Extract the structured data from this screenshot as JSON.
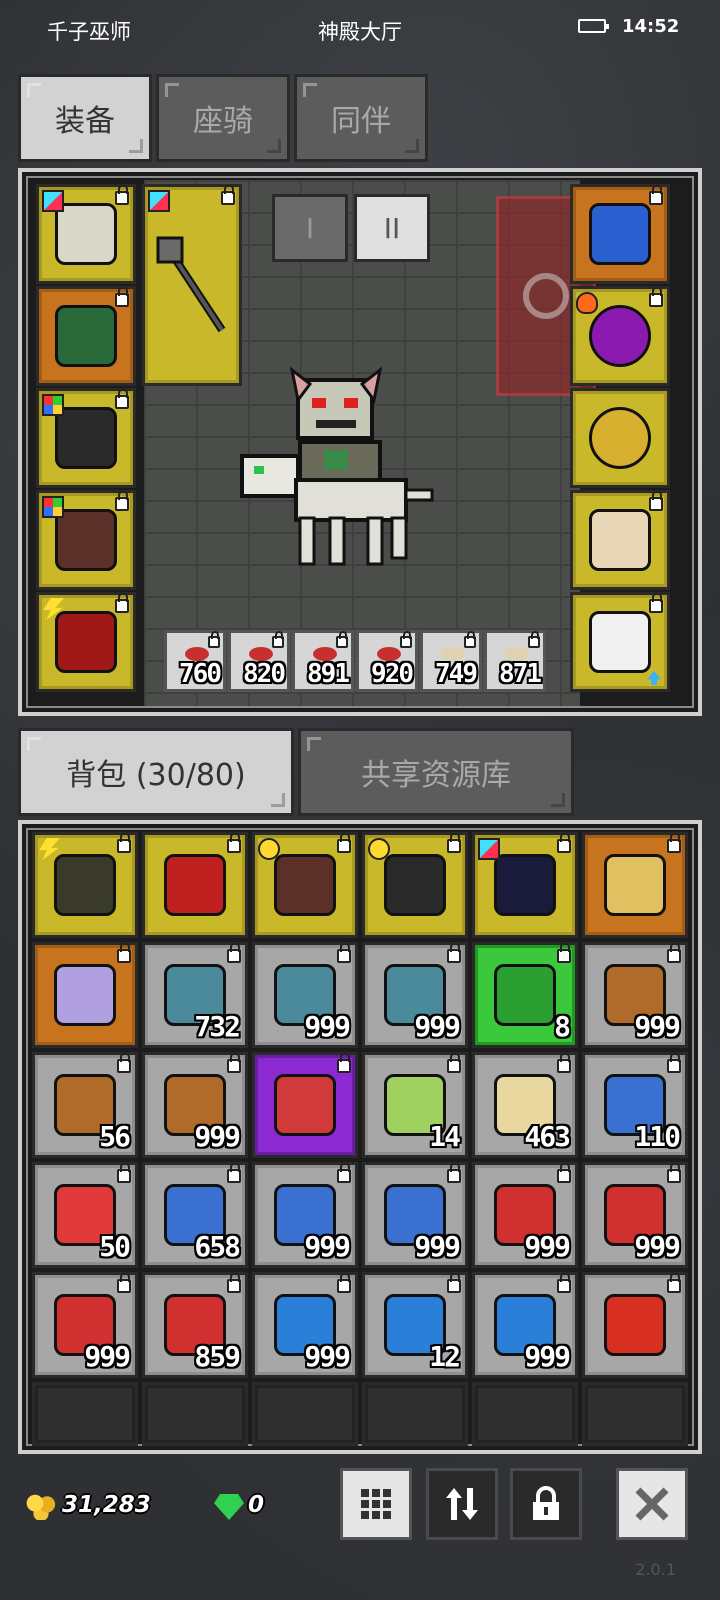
{
  "status": {
    "left": "千子巫师",
    "center": "神殿大厅",
    "time": "14:52"
  },
  "tabs": [
    {
      "label": "装备",
      "active": true
    },
    {
      "label": "座骑",
      "active": false
    },
    {
      "label": "同伴",
      "active": false
    }
  ],
  "equipment": {
    "page_buttons": [
      "I",
      "II"
    ],
    "active_page": "II",
    "left_slots": [
      {
        "name": "skull-helmet-icon",
        "color": "yellow",
        "badge": "cyan"
      },
      {
        "name": "green-armor-icon",
        "color": "orange",
        "badge": ""
      },
      {
        "name": "black-gauntlet-icon",
        "color": "yellow",
        "badge": "multi"
      },
      {
        "name": "leather-boots-icon",
        "color": "yellow",
        "badge": "multi"
      },
      {
        "name": "red-bag-icon",
        "color": "yellow",
        "badge": "bolt"
      }
    ],
    "weapon_slot": {
      "name": "mace-weapon-icon",
      "color": "yellow",
      "badge": "cyan"
    },
    "right_slots": [
      {
        "name": "blue-amulet-icon",
        "color": "orange",
        "badge": ""
      },
      {
        "name": "purple-gem-ring-icon",
        "color": "yellow",
        "badge": "fire"
      },
      {
        "name": "gold-ring-icon",
        "color": "yellow",
        "badge": ""
      },
      {
        "name": "skeleton-horse-card-icon",
        "color": "yellow",
        "badge": ""
      },
      {
        "name": "white-pet-icon",
        "color": "yellow",
        "badge": ""
      }
    ],
    "consumables": [
      {
        "qty": "760",
        "kind": "red"
      },
      {
        "qty": "820",
        "kind": "red"
      },
      {
        "qty": "891",
        "kind": "red"
      },
      {
        "qty": "920",
        "kind": "red"
      },
      {
        "qty": "749",
        "kind": "beige"
      },
      {
        "qty": "871",
        "kind": "beige"
      }
    ]
  },
  "bag_tabs": [
    {
      "label": "背包 (30/80)",
      "active": true
    },
    {
      "label": "共享资源库",
      "active": false
    }
  ],
  "bag": [
    {
      "name": "black-belt-icon",
      "color": "yellow",
      "qty": "",
      "badge": "bolt",
      "fill": "#3a3a2a"
    },
    {
      "name": "ruby-ring-icon",
      "color": "yellow",
      "qty": "",
      "badge": "",
      "fill": "#c02020"
    },
    {
      "name": "boots-icon",
      "color": "yellow",
      "qty": "",
      "badge": "sun",
      "fill": "#5a3028"
    },
    {
      "name": "gauntlet-icon",
      "color": "yellow",
      "qty": "",
      "badge": "sun",
      "fill": "#2a2a2a"
    },
    {
      "name": "flail-icon",
      "color": "yellow",
      "qty": "",
      "badge": "cyan",
      "fill": "#1a1a3a"
    },
    {
      "name": "moon-shield-icon",
      "color": "orange",
      "qty": "",
      "badge": "",
      "fill": "#e0c060"
    },
    {
      "name": "wizard-card-icon",
      "color": "orange",
      "qty": "",
      "badge": "",
      "fill": "#b0a0e0"
    },
    {
      "name": "fish-icon",
      "color": "gray",
      "qty": "732",
      "badge": "",
      "fill": "#4a8a9a"
    },
    {
      "name": "fish-icon",
      "color": "gray",
      "qty": "999",
      "badge": "",
      "fill": "#4a8a9a"
    },
    {
      "name": "fish-icon",
      "color": "gray",
      "qty": "999",
      "badge": "",
      "fill": "#4a8a9a"
    },
    {
      "name": "green-feather-icon",
      "color": "green",
      "qty": "8",
      "badge": "",
      "fill": "#2aa030"
    },
    {
      "name": "bread-icon",
      "color": "gray",
      "qty": "999",
      "badge": "",
      "fill": "#b06a2a"
    },
    {
      "name": "bread-icon",
      "color": "gray",
      "qty": "56",
      "badge": "",
      "fill": "#b06a2a"
    },
    {
      "name": "bread-icon",
      "color": "gray",
      "qty": "999",
      "badge": "",
      "fill": "#b06a2a"
    },
    {
      "name": "gem-chest-icon",
      "color": "purple",
      "qty": "",
      "badge": "",
      "fill": "#d03a3a"
    },
    {
      "name": "green-bag-icon",
      "color": "gray",
      "qty": "14",
      "badge": "",
      "fill": "#a0d060"
    },
    {
      "name": "scroll-icon",
      "color": "gray",
      "qty": "463",
      "badge": "",
      "fill": "#e8d8a0"
    },
    {
      "name": "blue-potion-icon",
      "color": "gray",
      "qty": "110",
      "badge": "",
      "fill": "#3a70d0"
    },
    {
      "name": "red-potion-icon",
      "color": "gray",
      "qty": "50",
      "badge": "",
      "fill": "#e03a3a"
    },
    {
      "name": "blue-vial-icon",
      "color": "gray",
      "qty": "658",
      "badge": "",
      "fill": "#3a70d0"
    },
    {
      "name": "blue-vial-icon",
      "color": "gray",
      "qty": "999",
      "badge": "",
      "fill": "#3a70d0"
    },
    {
      "name": "blue-vial-icon",
      "color": "gray",
      "qty": "999",
      "badge": "",
      "fill": "#3a70d0"
    },
    {
      "name": "red-vial-icon",
      "color": "gray",
      "qty": "999",
      "badge": "",
      "fill": "#d03030"
    },
    {
      "name": "red-vial-icon",
      "color": "gray",
      "qty": "999",
      "badge": "",
      "fill": "#d03030"
    },
    {
      "name": "red-vial-icon",
      "color": "gray",
      "qty": "999",
      "badge": "",
      "fill": "#d03030"
    },
    {
      "name": "red-vial-icon",
      "color": "gray",
      "qty": "859",
      "badge": "",
      "fill": "#d03030"
    },
    {
      "name": "blue-leaf-icon",
      "color": "gray",
      "qty": "999",
      "badge": "",
      "fill": "#2a80d8"
    },
    {
      "name": "blue-leaf-icon",
      "color": "gray",
      "qty": "12",
      "badge": "",
      "fill": "#2a80d8"
    },
    {
      "name": "blue-leaf-icon",
      "color": "gray",
      "qty": "999",
      "badge": "",
      "fill": "#2a80d8"
    },
    {
      "name": "red-leaf-icon",
      "color": "gray",
      "qty": "",
      "badge": "",
      "fill": "#d83020"
    },
    {
      "name": "empty-slot",
      "color": "empty",
      "qty": "",
      "badge": "",
      "fill": ""
    },
    {
      "name": "empty-slot",
      "color": "empty",
      "qty": "",
      "badge": "",
      "fill": ""
    },
    {
      "name": "empty-slot",
      "color": "empty",
      "qty": "",
      "badge": "",
      "fill": ""
    },
    {
      "name": "empty-slot",
      "color": "empty",
      "qty": "",
      "badge": "",
      "fill": ""
    },
    {
      "name": "empty-slot",
      "color": "empty",
      "qty": "",
      "badge": "",
      "fill": ""
    },
    {
      "name": "empty-slot",
      "color": "empty",
      "qty": "",
      "badge": "",
      "fill": ""
    }
  ],
  "footer": {
    "gold": "31,283",
    "gems": "0",
    "version": "2.0.1",
    "buttons": [
      "grid-icon",
      "sort-icon",
      "lock-icon",
      "close-icon"
    ]
  }
}
